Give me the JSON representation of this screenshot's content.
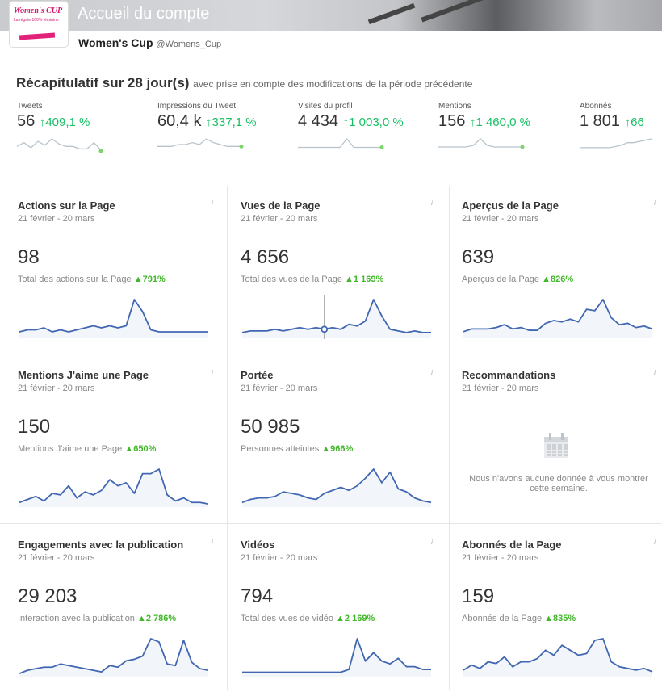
{
  "header": {
    "title": "Accueil du compte",
    "account_name": "Women's Cup",
    "handle": "@Womens_Cup",
    "logo_line1": "Women's CUP",
    "logo_line2": "La régate 100% féminine"
  },
  "summary": {
    "title": "Récapitulatif sur 28 jour(s)",
    "subtitle": "avec prise en compte des modifications de la période précédente"
  },
  "metrics": [
    {
      "label": "Tweets",
      "value": "56",
      "change": "↑409,1 %"
    },
    {
      "label": "Impressions du Tweet",
      "value": "60,4 k",
      "change": "↑337,1 %"
    },
    {
      "label": "Visites du profil",
      "value": "4 434",
      "change": "↑1 003,0 %"
    },
    {
      "label": "Mentions",
      "value": "156",
      "change": "↑1 460,0 %"
    },
    {
      "label": "Abonnés",
      "value": "1 801",
      "change": "↑66"
    }
  ],
  "cards": [
    {
      "title": "Actions sur la Page",
      "dates": "21 février - 20 mars",
      "value": "98",
      "desc": "Total des actions sur la Page",
      "pct": "▲791%",
      "series": [
        2,
        3,
        3,
        4,
        2,
        3,
        2,
        3,
        4,
        5,
        4,
        5,
        4,
        5,
        18,
        12,
        3,
        2,
        2,
        2,
        2,
        2,
        2,
        2
      ]
    },
    {
      "title": "Vues de la Page",
      "dates": "21 février - 20 mars",
      "value": "4 656",
      "desc": "Total des vues de la Page",
      "pct": "▲1 169%",
      "series": [
        2,
        3,
        3,
        3,
        4,
        3,
        4,
        5,
        4,
        5,
        4,
        5,
        4,
        7,
        6,
        9,
        22,
        12,
        4,
        3,
        2,
        3,
        2,
        2
      ]
    },
    {
      "title": "Aperçus de la Page",
      "dates": "21 février - 20 mars",
      "value": "639",
      "desc": "Aperçus de la Page",
      "pct": "▲826%",
      "series": [
        3,
        5,
        5,
        5,
        6,
        8,
        5,
        6,
        4,
        4,
        9,
        11,
        10,
        12,
        10,
        19,
        18,
        26,
        13,
        8,
        9,
        6,
        7,
        5
      ]
    },
    {
      "title": "Mentions J'aime une Page",
      "dates": "21 février - 20 mars",
      "value": "150",
      "desc": "Mentions J'aime une Page",
      "pct": "▲650%",
      "series": [
        2,
        4,
        6,
        3,
        8,
        7,
        13,
        5,
        9,
        7,
        10,
        17,
        13,
        15,
        8,
        21,
        21,
        24,
        7,
        3,
        5,
        2,
        2,
        1
      ]
    },
    {
      "title": "Portée",
      "dates": "21 février - 20 mars",
      "value": "50 985",
      "desc": "Personnes atteintes",
      "pct": "▲966%",
      "series": [
        2,
        4,
        5,
        5,
        6,
        9,
        8,
        7,
        5,
        4,
        8,
        10,
        12,
        10,
        13,
        18,
        24,
        15,
        22,
        11,
        9,
        5,
        3,
        2
      ]
    },
    {
      "title": "Recommandations",
      "dates": "21 février - 20 mars",
      "empty": "Nous n'avons aucune donnée à vous montrer cette semaine."
    },
    {
      "title": "Engagements avec la publication",
      "dates": "21 février - 20 mars",
      "value": "29 203",
      "desc": "Interaction avec la publication",
      "pct": "▲2 786%",
      "series": [
        1,
        3,
        4,
        5,
        5,
        7,
        6,
        5,
        4,
        3,
        2,
        6,
        5,
        9,
        10,
        12,
        23,
        21,
        7,
        6,
        22,
        8,
        4,
        3
      ]
    },
    {
      "title": "Vidéos",
      "dates": "21 février - 20 mars",
      "value": "794",
      "desc": "Total des vues de vidéo",
      "pct": "▲2 169%",
      "series": [
        1,
        1,
        1,
        1,
        1,
        1,
        1,
        1,
        1,
        1,
        1,
        1,
        1,
        2,
        13,
        5,
        8,
        5,
        4,
        6,
        3,
        3,
        2,
        2
      ]
    },
    {
      "title": "Abonnés de la Page",
      "dates": "21 février - 20 mars",
      "value": "159",
      "desc": "Abonnés de la Page",
      "pct": "▲835%",
      "series": [
        3,
        6,
        4,
        8,
        7,
        11,
        5,
        8,
        8,
        10,
        15,
        12,
        18,
        15,
        12,
        13,
        21,
        22,
        8,
        5,
        4,
        3,
        4,
        2
      ]
    }
  ],
  "colors": {
    "accent_green": "#17bf63",
    "line_blue": "#4267b2",
    "pct_green": "#42b72a"
  },
  "icons": {
    "info": "info-icon",
    "calendar": "calendar-icon"
  }
}
